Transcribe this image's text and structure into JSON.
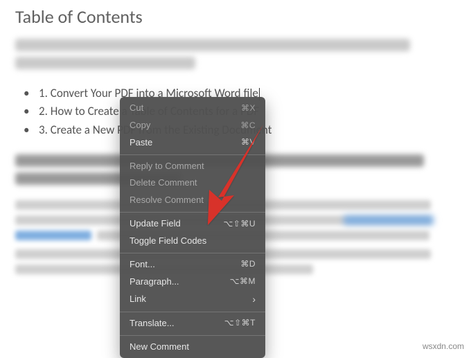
{
  "toc": {
    "title": "Table of Contents",
    "items": [
      "1. Convert Your PDF into a Microsoft Word file",
      "2. How to Create a Table of Contents for a PDF",
      "3. Create a New PDF from the Existing Document"
    ]
  },
  "context_menu": {
    "cut": {
      "label": "Cut",
      "shortcut": "⌘X"
    },
    "copy": {
      "label": "Copy",
      "shortcut": "⌘C"
    },
    "paste": {
      "label": "Paste",
      "shortcut": "⌘V"
    },
    "reply": {
      "label": "Reply to Comment"
    },
    "delete_comment": {
      "label": "Delete Comment"
    },
    "resolve": {
      "label": "Resolve Comment"
    },
    "update_field": {
      "label": "Update Field",
      "shortcut": "⌥⇧⌘U"
    },
    "toggle_field": {
      "label": "Toggle Field Codes"
    },
    "font": {
      "label": "Font...",
      "shortcut": "⌘D"
    },
    "paragraph": {
      "label": "Paragraph...",
      "shortcut": "⌥⌘M"
    },
    "link": {
      "label": "Link",
      "submenu": "›"
    },
    "translate": {
      "label": "Translate...",
      "shortcut": "⌥⇧⌘T"
    },
    "new_comment": {
      "label": "New Comment"
    }
  },
  "watermark": "wsxdn.com"
}
